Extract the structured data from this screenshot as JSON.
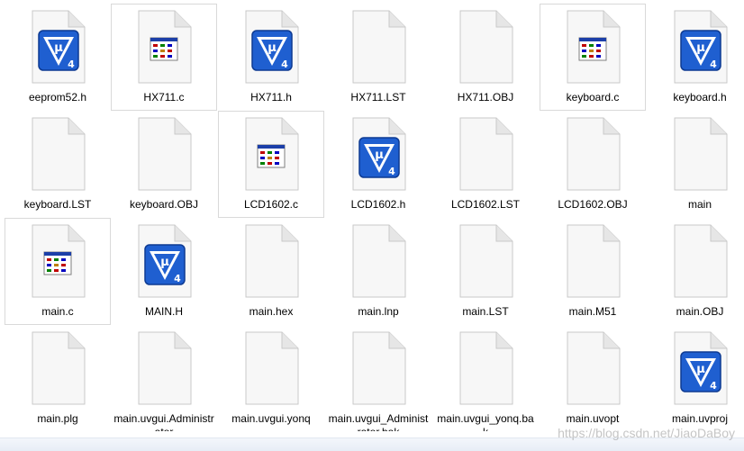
{
  "files": [
    {
      "name": "eeprom52.h",
      "icon": "keil-uvision-icon",
      "outlined": false
    },
    {
      "name": "HX711.c",
      "icon": "c-source-file-icon",
      "outlined": true
    },
    {
      "name": "HX711.h",
      "icon": "keil-uvision-icon",
      "outlined": false
    },
    {
      "name": "HX711.LST",
      "icon": "blank-file-icon",
      "outlined": false
    },
    {
      "name": "HX711.OBJ",
      "icon": "blank-file-icon",
      "outlined": false
    },
    {
      "name": "keyboard.c",
      "icon": "c-source-file-icon",
      "outlined": true
    },
    {
      "name": "keyboard.h",
      "icon": "keil-uvision-icon",
      "outlined": false
    },
    {
      "name": "keyboard.LST",
      "icon": "blank-file-icon",
      "outlined": false
    },
    {
      "name": "keyboard.OBJ",
      "icon": "blank-file-icon",
      "outlined": false
    },
    {
      "name": "LCD1602.c",
      "icon": "c-source-file-icon",
      "outlined": true
    },
    {
      "name": "LCD1602.h",
      "icon": "keil-uvision-icon",
      "outlined": false
    },
    {
      "name": "LCD1602.LST",
      "icon": "blank-file-icon",
      "outlined": false
    },
    {
      "name": "LCD1602.OBJ",
      "icon": "blank-file-icon",
      "outlined": false
    },
    {
      "name": "main",
      "icon": "blank-file-icon",
      "outlined": false
    },
    {
      "name": "main.c",
      "icon": "c-source-file-icon",
      "outlined": true
    },
    {
      "name": "MAIN.H",
      "icon": "keil-uvision-icon",
      "outlined": false
    },
    {
      "name": "main.hex",
      "icon": "blank-file-icon",
      "outlined": false
    },
    {
      "name": "main.lnp",
      "icon": "blank-file-icon",
      "outlined": false
    },
    {
      "name": "main.LST",
      "icon": "blank-file-icon",
      "outlined": false
    },
    {
      "name": "main.M51",
      "icon": "blank-file-icon",
      "outlined": false
    },
    {
      "name": "main.OBJ",
      "icon": "blank-file-icon",
      "outlined": false
    },
    {
      "name": "main.plg",
      "icon": "blank-file-icon",
      "outlined": false
    },
    {
      "name": "main.uvgui.Administrator",
      "icon": "blank-file-icon",
      "outlined": false
    },
    {
      "name": "main.uvgui.yonq",
      "icon": "blank-file-icon",
      "outlined": false
    },
    {
      "name": "main.uvgui_Administrator.bak",
      "icon": "blank-file-icon",
      "outlined": false
    },
    {
      "name": "main.uvgui_yonq.bak",
      "icon": "blank-file-icon",
      "outlined": false
    },
    {
      "name": "main.uvopt",
      "icon": "blank-file-icon",
      "outlined": false
    },
    {
      "name": "main.uvproj",
      "icon": "keil-uvision-icon",
      "outlined": false
    }
  ],
  "watermark": "https://blog.csdn.net/JiaoDaBoy",
  "colors": {
    "keil_blue": "#1f5fd0",
    "keil_blue_dark": "#0d3a92",
    "tile_outline": "#d9d9d9"
  }
}
